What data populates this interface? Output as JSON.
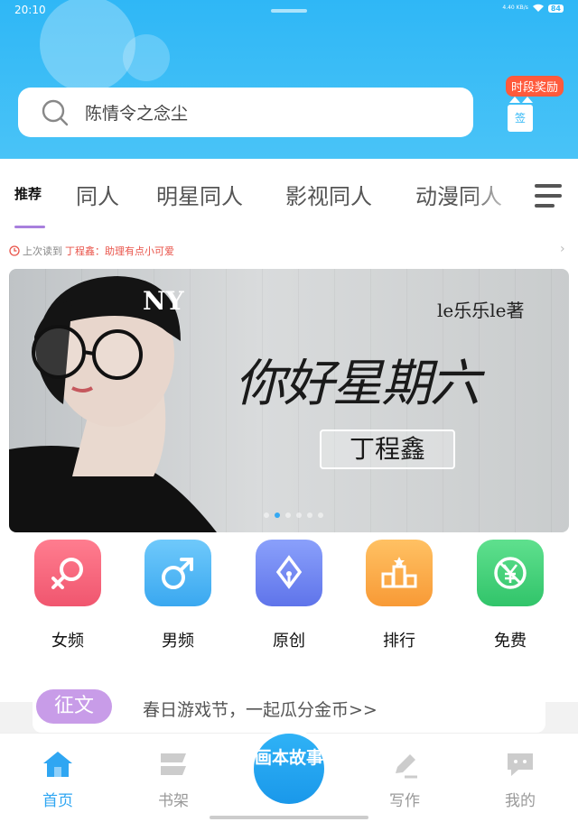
{
  "status": {
    "time": "20:10",
    "network": "4.40 KB/s",
    "battery": "84"
  },
  "search": {
    "placeholder": "陈情令之念尘"
  },
  "reward": {
    "label": "时段奖励",
    "sign": "签"
  },
  "tabs": {
    "active": "推荐",
    "items": [
      "同人",
      "明星同人",
      "影视同人",
      "动漫同人"
    ]
  },
  "last_read": {
    "prefix": "上次读到",
    "title": "丁程鑫：助理有点小可爱"
  },
  "banner": {
    "author": "le乐乐le著",
    "title": "你好星期六",
    "subtitle": "丁程鑫",
    "dots_total": 6,
    "dots_active": 2
  },
  "quick_links": [
    {
      "label": "女频",
      "icon": "female-icon",
      "color": "#f25f7a"
    },
    {
      "label": "男频",
      "icon": "male-icon",
      "color": "#49b4f4"
    },
    {
      "label": "原创",
      "icon": "fountain-pen-icon",
      "color": "#6d84f2"
    },
    {
      "label": "排行",
      "icon": "podium-icon",
      "color": "#fbab45"
    },
    {
      "label": "免费",
      "icon": "free-yen-icon",
      "color": "#3fcf78"
    }
  ],
  "notice": {
    "tag": "征文",
    "text": "春日游戏节，一起瓜分金币>>"
  },
  "bottom_nav": {
    "home": "首页",
    "shelf": "书架",
    "center": "画本故事",
    "write": "写作",
    "mine": "我的"
  },
  "colors": {
    "header": "#2fb7f6",
    "accent": "#2fa6f2",
    "tab_underline": "#a87fdd",
    "last_read_title": "#e9544a"
  }
}
